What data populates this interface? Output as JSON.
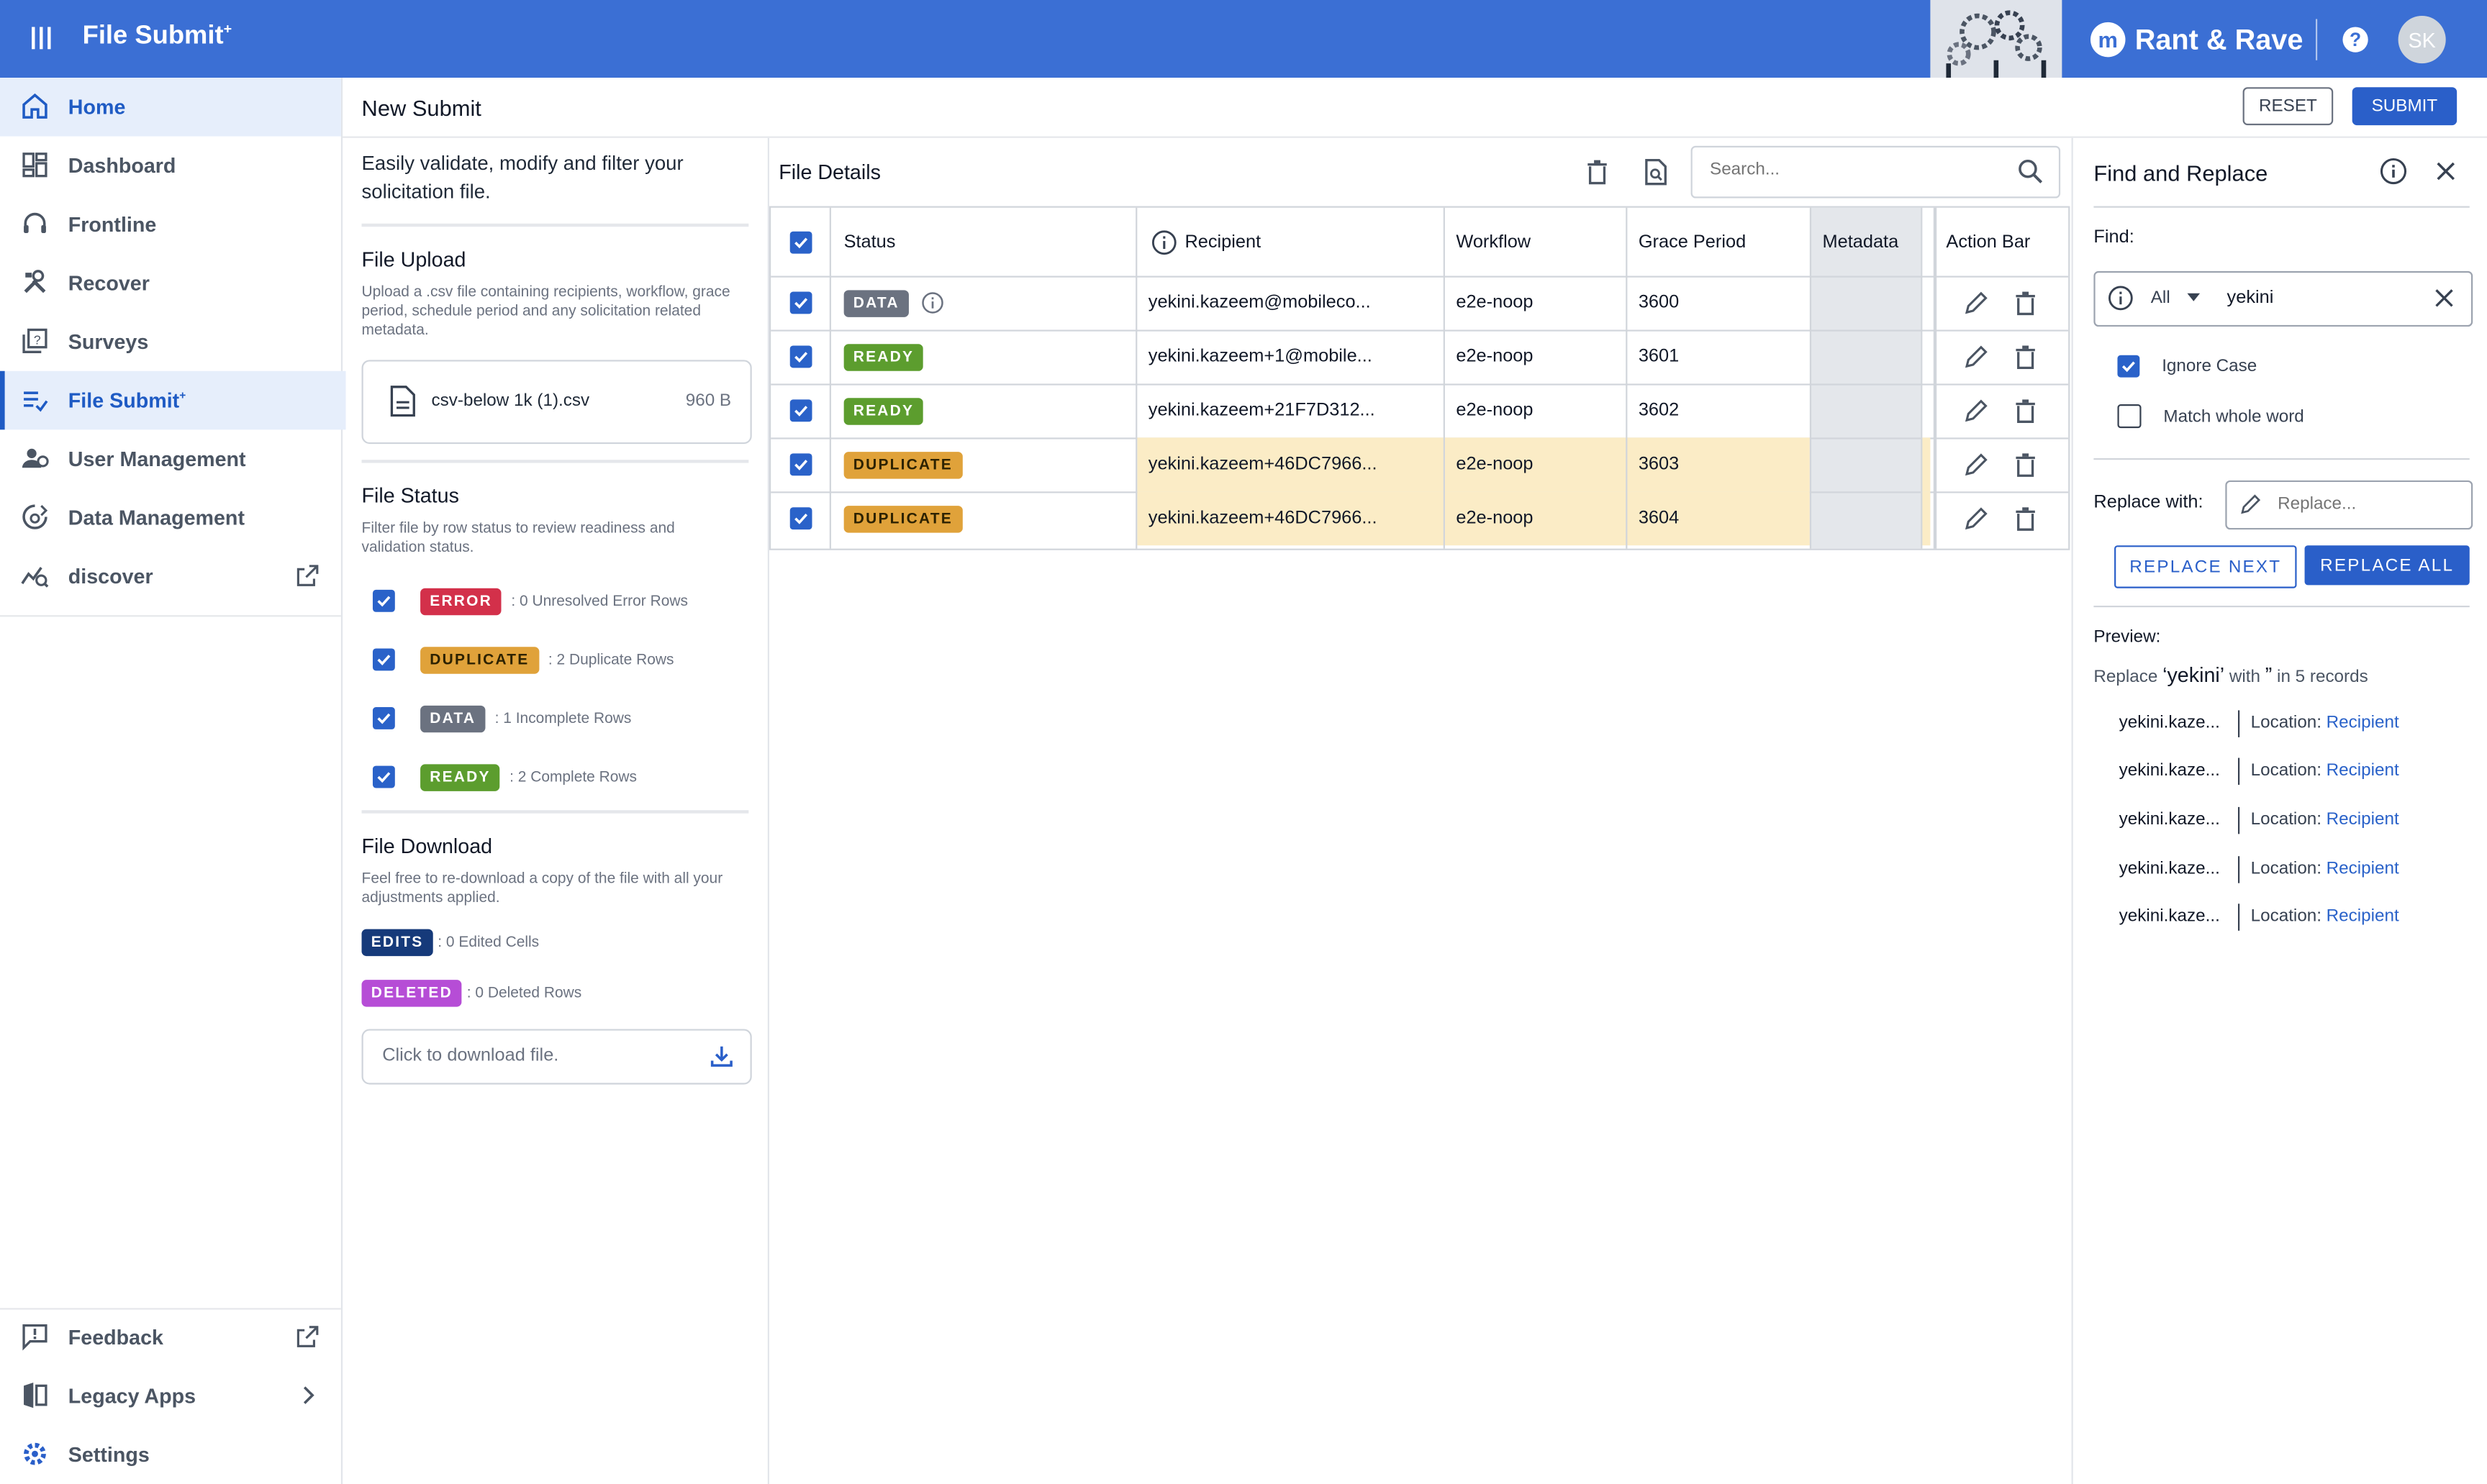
{
  "app": {
    "title": "File Submit",
    "title_suffix": "+",
    "brand": "Rant & Rave",
    "brand_logo": "m",
    "user_initials": "SK"
  },
  "colors": {
    "topbar": "#3b6fd4",
    "primary": "#2a5fc9",
    "error": "#d3304a",
    "duplicate": "#e0a23a",
    "data": "#6b7280",
    "ready": "#5c9d2e",
    "edits": "#163a7a",
    "deleted": "#b64dd6"
  },
  "sidebar": {
    "items": [
      {
        "label": "Home",
        "icon": "home-icon"
      },
      {
        "label": "Dashboard",
        "icon": "dashboard-icon"
      },
      {
        "label": "Frontline",
        "icon": "headset-icon"
      },
      {
        "label": "Recover",
        "icon": "tools-icon"
      },
      {
        "label": "Surveys",
        "icon": "survey-icon"
      },
      {
        "label": "File Submit",
        "suffix": "+",
        "icon": "file-submit-icon"
      },
      {
        "label": "User Management",
        "icon": "users-icon"
      },
      {
        "label": "Data Management",
        "icon": "data-management-icon"
      },
      {
        "label": "discover",
        "icon": "discover-icon"
      }
    ],
    "bottom": [
      {
        "label": "Feedback",
        "icon": "feedback-icon"
      },
      {
        "label": "Legacy Apps",
        "icon": "legacy-apps-icon"
      },
      {
        "label": "Settings",
        "icon": "settings-icon"
      }
    ]
  },
  "header": {
    "page_title": "New Submit",
    "reset_label": "RESET",
    "submit_label": "SUBMIT"
  },
  "left_panel": {
    "intro": "Easily validate, modify and filter your solicitation file.",
    "upload": {
      "title": "File Upload",
      "description": "Upload a .csv file containing recipients, workflow, grace period, schedule period and any solicitation related metadata.",
      "file_name": "csv-below 1k (1).csv",
      "file_size": "960 B"
    },
    "status": {
      "title": "File Status",
      "description": "Filter file by row status to review readiness and validation status.",
      "items": [
        {
          "badge": "ERROR",
          "text": ": 0 Unresolved Error Rows"
        },
        {
          "badge": "DUPLICATE",
          "text": ": 2 Duplicate Rows"
        },
        {
          "badge": "DATA",
          "text": ": 1 Incomplete Rows"
        },
        {
          "badge": "READY",
          "text": ": 2 Complete Rows"
        }
      ]
    },
    "download": {
      "title": "File Download",
      "description": "Feel free to re-download a copy of the file with all your adjustments applied.",
      "edits_badge": "EDITS",
      "edits_text": ": 0 Edited Cells",
      "deleted_badge": "DELETED",
      "deleted_text": ": 0 Deleted Rows",
      "button_text": "Click to download file."
    }
  },
  "file_details": {
    "title": "File Details",
    "search_placeholder": "Search...",
    "columns": {
      "status": "Status",
      "recipient": "Recipient",
      "workflow": "Workflow",
      "grace_period": "Grace Period",
      "metadata": "Metadata",
      "action_bar": "Action Bar"
    },
    "rows": [
      {
        "status": "DATA",
        "recipient": "yekini.kazeem@mobileco...",
        "workflow": "e2e-noop",
        "grace_period": "3600"
      },
      {
        "status": "READY",
        "recipient": "yekini.kazeem+1@mobile...",
        "workflow": "e2e-noop",
        "grace_period": "3601"
      },
      {
        "status": "READY",
        "recipient": "yekini.kazeem+21F7D312...",
        "workflow": "e2e-noop",
        "grace_period": "3602"
      },
      {
        "status": "DUPLICATE",
        "recipient": "yekini.kazeem+46DC7966...",
        "workflow": "e2e-noop",
        "grace_period": "3603"
      },
      {
        "status": "DUPLICATE",
        "recipient": "yekini.kazeem+46DC7966...",
        "workflow": "e2e-noop",
        "grace_period": "3604"
      }
    ]
  },
  "find_replace": {
    "title": "Find and Replace",
    "find_label": "Find:",
    "scope": "All",
    "find_value": "yekini",
    "ignore_case_label": "Ignore Case",
    "match_whole_label": "Match whole word",
    "replace_label": "Replace with:",
    "replace_placeholder": "Replace...",
    "replace_next": "REPLACE NEXT",
    "replace_all": "REPLACE ALL",
    "preview_label": "Preview:",
    "preview_prefix": "Replace",
    "preview_term": "‘yekini’",
    "preview_with": "with",
    "preview_replacement": "”",
    "preview_suffix": "in 5 records",
    "preview_rows": [
      {
        "value": "yekini.kaze...",
        "location_label": "Location:",
        "field": "Recipient"
      },
      {
        "value": "yekini.kaze...",
        "location_label": "Location:",
        "field": "Recipient"
      },
      {
        "value": "yekini.kaze...",
        "location_label": "Location:",
        "field": "Recipient"
      },
      {
        "value": "yekini.kaze...",
        "location_label": "Location:",
        "field": "Recipient"
      },
      {
        "value": "yekini.kaze...",
        "location_label": "Location:",
        "field": "Recipient"
      }
    ]
  }
}
